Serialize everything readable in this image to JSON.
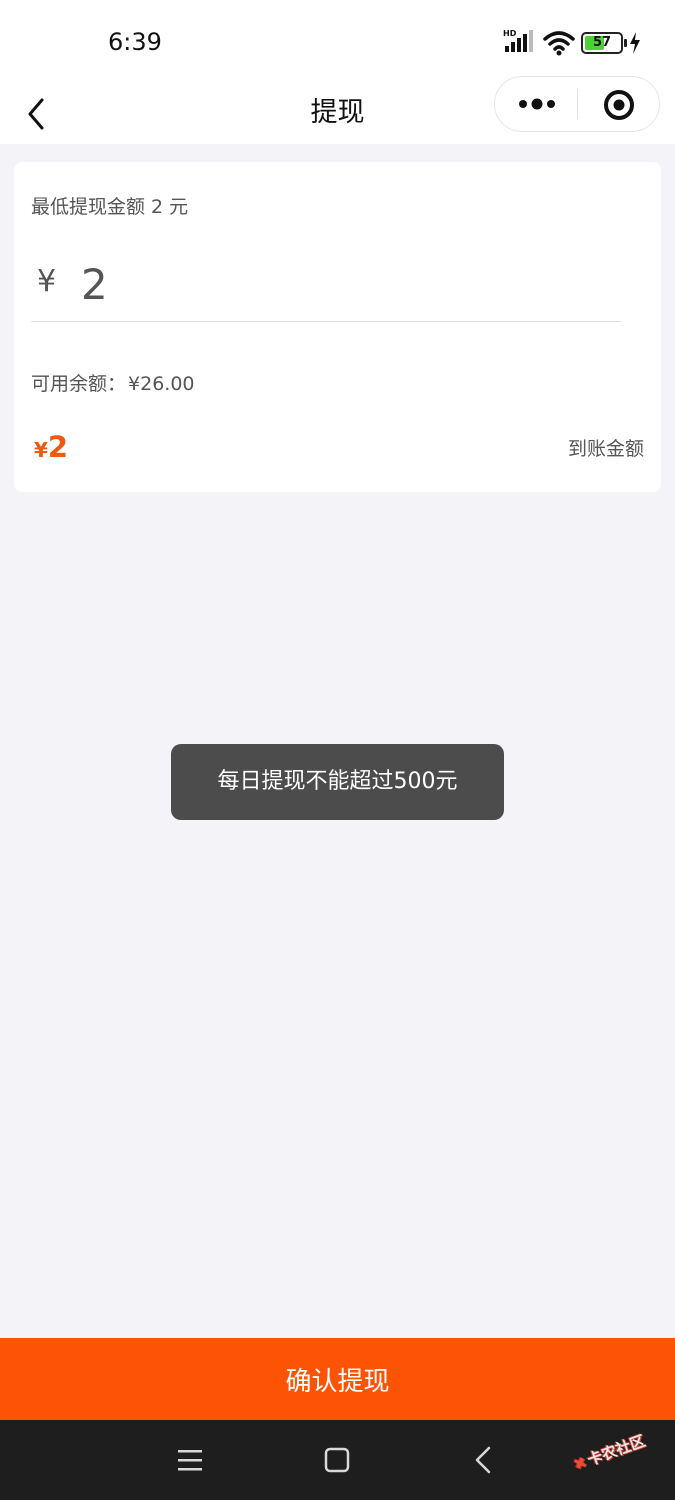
{
  "status_bar": {
    "time": "6:39",
    "network_label": "HD",
    "battery_percent": 57,
    "battery_text": "57",
    "icons": [
      "signal-icon",
      "wifi-icon",
      "battery-icon",
      "charging-icon"
    ]
  },
  "nav": {
    "title": "提现",
    "icons": [
      "back-arrow-icon",
      "more-dots-icon",
      "target-icon"
    ]
  },
  "form": {
    "min_hint": "最低提现金额 2 元",
    "currency_symbol": "¥",
    "amount_value": "2",
    "balance_label": "可用余额：",
    "balance_value": "¥26.00",
    "arrival_currency": "¥",
    "arrival_amount": "2",
    "arrival_label": "到账金额"
  },
  "toast": {
    "message": "每日提现不能超过500元"
  },
  "confirm_button": {
    "label": "确认提现"
  },
  "system_nav": {
    "icons": [
      "menu-icon",
      "home-icon",
      "back-icon"
    ],
    "watermark": "卡农社区"
  },
  "colors": {
    "accent": "#fd5304",
    "amount_highlight": "#f05a0e",
    "page_background": "#f4f4f8",
    "toast_background": "#4c4c4c",
    "system_nav_background": "#1e1e1e"
  }
}
